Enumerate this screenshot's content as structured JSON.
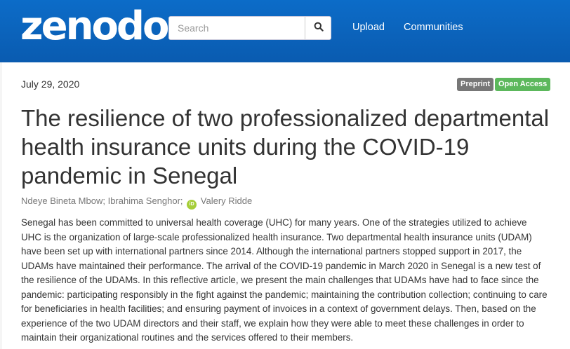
{
  "header": {
    "logo_text": "zenodo",
    "search": {
      "placeholder": "Search"
    },
    "nav": {
      "upload_label": "Upload",
      "communities_label": "Communities"
    },
    "icons": {
      "search_icon": "magnifier"
    },
    "colors": {
      "header_bg": "#0a64be",
      "preprint_badge": "#777777",
      "open_access_badge": "#5cb85c",
      "orcid": "#a6ce39"
    }
  },
  "record": {
    "date": "July 29, 2020",
    "badges": {
      "preprint": "Preprint",
      "open_access": "Open Access"
    },
    "title": "The resilience of two professionalized departmental health insurance units during the COVID-19 pandemic in Senegal",
    "authors": {
      "a1": "Ndeye Bineta Mbow;",
      "a2": "Ibrahima Senghor;",
      "orcid_label": "iD",
      "a3": "Valery Ridde"
    },
    "abstract": "Senegal has been committed to universal health coverage (UHC) for many years. One of the strategies utilized to achieve UHC is the organization of large-scale professionalized health insurance. Two departmental health insurance units (UDAM) have been set up with international partners since 2014. Although the international partners stopped support in 2017, the UDAMs have maintained their performance. The arrival of the COVID-19 pandemic in March 2020 in Senegal is a new test of the resilience of the UDAMs. In this reflective article, we present the main challenges that UDAMs have had to face since the pandemic: participating responsibly in the fight against the pandemic; maintaining the contribution collection; continuing to care for beneficiaries in health facilities; and ensuring payment of invoices in a context of government delays. Then, based on the experience of the two UDAM directors and their staff, we explain how they were able to meet these challenges in order to maintain their organizational routines and the services offered to their members."
  }
}
